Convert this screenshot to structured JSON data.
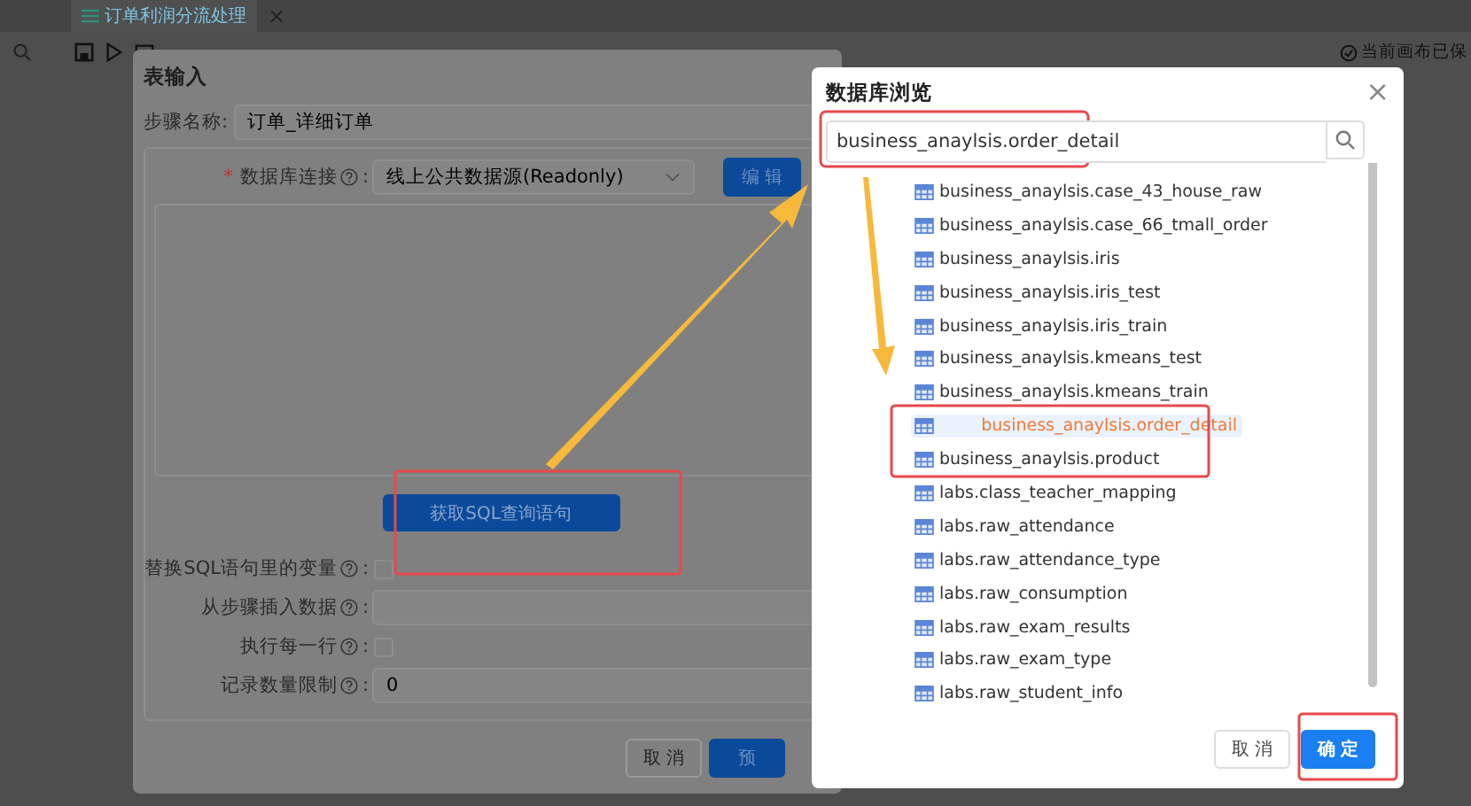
{
  "app": {
    "tab_title": "订单利润分流处理",
    "tab_close": "×",
    "save_status": "当前画布已保"
  },
  "table_input_dialog": {
    "title": "表输入",
    "step_name": {
      "label": "步骤名称:",
      "value": "订单_详细订单"
    },
    "connection": {
      "required_mark": "*",
      "label": "数据库连接",
      "colon": ":",
      "value": "线上公共数据源(Readonly)",
      "edit_button": "编 辑"
    },
    "sql_button": "获取SQL查询语句",
    "options": [
      {
        "kind": "checkbox",
        "label": "替换SQL语句里的变量",
        "colon": ":",
        "checked": false
      },
      {
        "kind": "field",
        "label": "从步骤插入数据",
        "colon": ":"
      },
      {
        "kind": "checkbox",
        "label": "执行每一行",
        "colon": ":",
        "checked": false
      },
      {
        "kind": "field",
        "label": "记录数量限制",
        "colon": ":",
        "value": "0"
      }
    ],
    "buttons": [
      {
        "label": "取 消",
        "kind": "secondary"
      },
      {
        "label": "预",
        "kind": "primary"
      }
    ]
  },
  "browser_dialog": {
    "title": "数据库浏览",
    "close": "×",
    "search": {
      "value": "business_anaylsis.order_detail"
    },
    "tables": [
      {
        "name": "business_anaylsis.case_43_house_raw",
        "selected": false
      },
      {
        "name": "business_anaylsis.case_66_tmall_order",
        "selected": false
      },
      {
        "name": "business_anaylsis.iris",
        "selected": false
      },
      {
        "name": "business_anaylsis.iris_test",
        "selected": false
      },
      {
        "name": "business_anaylsis.iris_train",
        "selected": false
      },
      {
        "name": "business_anaylsis.kmeans_test",
        "selected": false
      },
      {
        "name": "business_anaylsis.kmeans_train",
        "selected": false
      },
      {
        "name": "business_anaylsis.order_detail",
        "selected": true
      },
      {
        "name": "business_anaylsis.product",
        "selected": false
      },
      {
        "name": "labs.class_teacher_mapping",
        "selected": false
      },
      {
        "name": "labs.raw_attendance",
        "selected": false
      },
      {
        "name": "labs.raw_attendance_type",
        "selected": false
      },
      {
        "name": "labs.raw_consumption",
        "selected": false
      },
      {
        "name": "labs.raw_exam_results",
        "selected": false
      },
      {
        "name": "labs.raw_exam_type",
        "selected": false
      },
      {
        "name": "labs.raw_student_info",
        "selected": false
      }
    ],
    "buttons": [
      {
        "label": "取 消",
        "kind": "secondary"
      },
      {
        "label": "确 定",
        "kind": "primary"
      }
    ]
  }
}
